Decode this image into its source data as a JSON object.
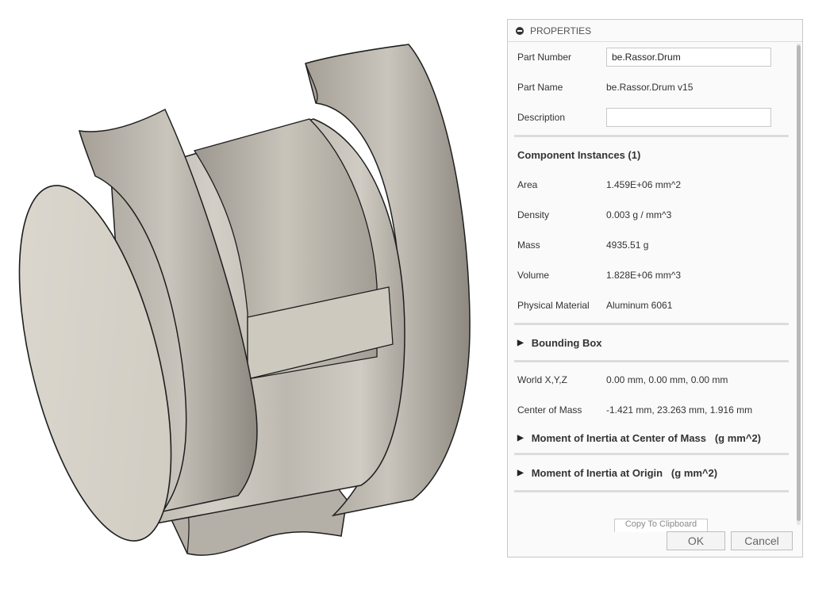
{
  "panel": {
    "title": "PROPERTIES",
    "part_number_label": "Part Number",
    "part_number_value": "be.Rassor.Drum",
    "part_name_label": "Part Name",
    "part_name_value": "be.Rassor.Drum v15",
    "description_label": "Description",
    "description_value": "",
    "component_instances": "Component Instances (1)",
    "area_label": "Area",
    "area_value": "1.459E+06 mm^2",
    "density_label": "Density",
    "density_value": "0.003 g / mm^3",
    "mass_label": "Mass",
    "mass_value": "4935.51 g",
    "volume_label": "Volume",
    "volume_value": "1.828E+06 mm^3",
    "material_label": "Physical Material",
    "material_value": "Aluminum 6061",
    "bounding_box": "Bounding Box",
    "world_label": "World X,Y,Z",
    "world_value": "0.00 mm, 0.00 mm, 0.00 mm",
    "com_label": "Center of Mass",
    "com_value": "-1.421 mm, 23.263 mm, 1.916 mm",
    "moi_com": "Moment of Inertia at Center of Mass   (g mm^2)",
    "moi_origin": "Moment of Inertia at Origin   (g mm^2)",
    "copy_partial": "Copy To Clipboard",
    "ok_label": "OK",
    "cancel_label": "Cancel"
  },
  "colors": {
    "panel_bg": "#fafafa",
    "model_face": "#c9c5bb",
    "model_edge": "#1e1e1e"
  },
  "icons": [
    "collapse-icon",
    "expand-triangle-icon"
  ]
}
